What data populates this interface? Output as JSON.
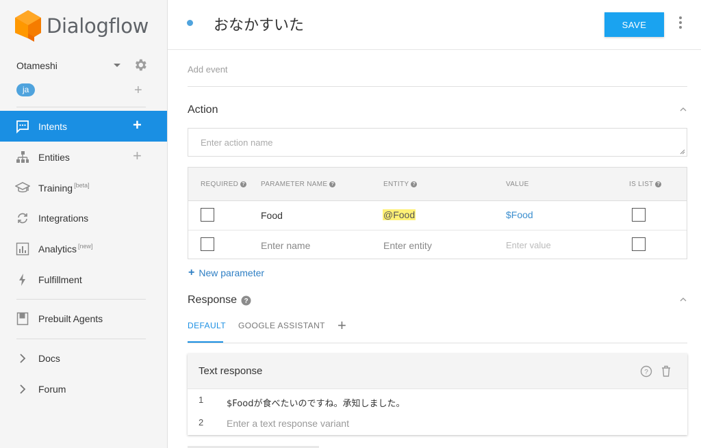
{
  "brand": {
    "name": "Dialogflow",
    "accent": "#1a8fe3",
    "logo_orange": "#ff9800"
  },
  "sidebar": {
    "agent_name": "Otameshi",
    "language": "ja",
    "items": [
      {
        "label": "Intents",
        "sup": "",
        "active": true
      },
      {
        "label": "Entities",
        "sup": ""
      },
      {
        "label": "Training",
        "sup": "[beta]"
      },
      {
        "label": "Integrations",
        "sup": ""
      },
      {
        "label": "Analytics",
        "sup": "[new]"
      },
      {
        "label": "Fulfillment",
        "sup": ""
      },
      {
        "label": "Prebuilt Agents",
        "sup": ""
      },
      {
        "label": "Docs",
        "sup": ""
      },
      {
        "label": "Forum",
        "sup": ""
      }
    ]
  },
  "header": {
    "intent_name": "おなかすいた",
    "save_label": "SAVE"
  },
  "events": {
    "placeholder": "Add event"
  },
  "action": {
    "title": "Action",
    "input_placeholder": "Enter action name",
    "table": {
      "headers": [
        "REQUIRED",
        "PARAMETER NAME",
        "ENTITY",
        "VALUE",
        "IS LIST"
      ],
      "rows": [
        {
          "name": "Food",
          "entity": "@Food",
          "value": "$Food"
        },
        {
          "name": "Enter name",
          "entity": "Enter entity",
          "value": "Enter value"
        }
      ]
    },
    "new_parameter": "New parameter"
  },
  "response": {
    "title": "Response",
    "tabs": [
      "DEFAULT",
      "GOOGLE ASSISTANT"
    ],
    "card": {
      "title": "Text response",
      "lines": [
        {
          "num": "1",
          "text": "$Foodが食べたいのですね。承知しました。"
        },
        {
          "num": "2",
          "text": "Enter a text response variant"
        }
      ]
    }
  }
}
